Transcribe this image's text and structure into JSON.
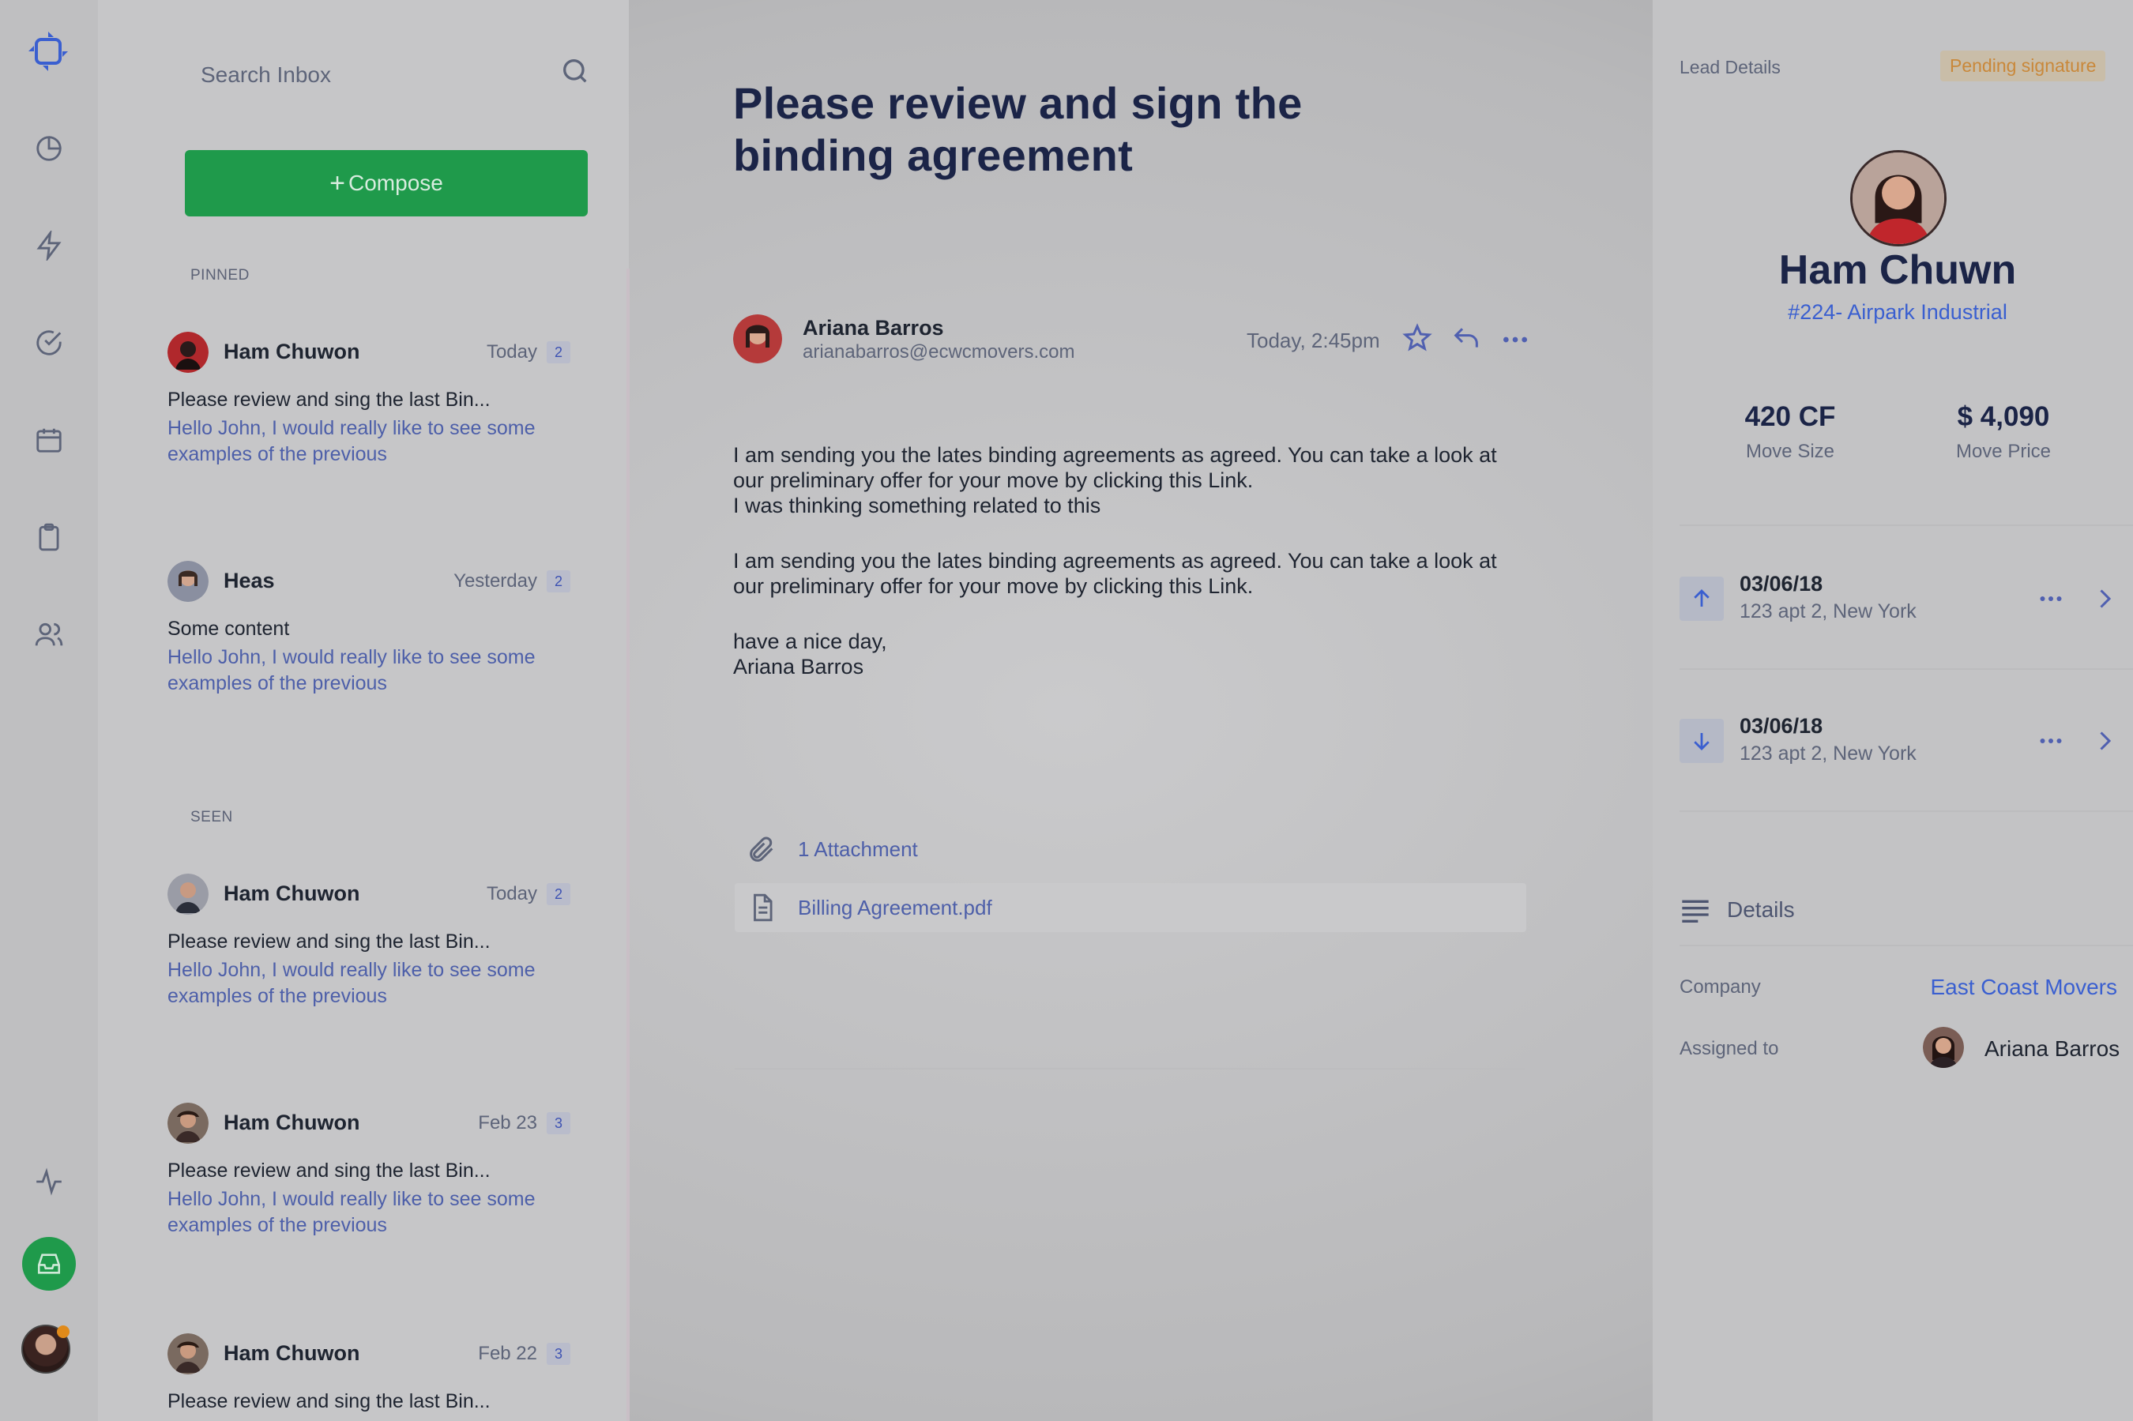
{
  "search": {
    "placeholder": "Search Inbox"
  },
  "compose": {
    "plus": "+",
    "label": "Compose"
  },
  "sections": {
    "pinned": "PINNED",
    "seen": "SEEN"
  },
  "messages": [
    {
      "sender": "Ham Chuwon",
      "date": "Today",
      "count": "2",
      "subject": "Please review and sing the last Bin...",
      "preview": "Hello John, I would really like to see some examples of the previous"
    },
    {
      "sender": "Heas",
      "date": "Yesterday",
      "count": "2",
      "subject": "Some content",
      "preview": "Hello John, I would really like to see some examples of the previous"
    },
    {
      "sender": "Ham Chuwon",
      "date": "Today",
      "count": "2",
      "subject": "Please review and sing the last Bin...",
      "preview": "Hello John, I would really like to see some examples of the previous"
    },
    {
      "sender": "Ham Chuwon",
      "date": "Feb 23",
      "count": "3",
      "subject": "Please review and sing the last Bin...",
      "preview": "Hello John, I would really like to see some examples of the previous"
    },
    {
      "sender": "Ham Chuwon",
      "date": "Feb 22",
      "count": "3",
      "subject": "Please review and sing the last Bin...",
      "preview": ""
    }
  ],
  "email": {
    "subject": "Please review and sign the binding agreement",
    "sender_name": "Ariana Barros",
    "sender_email": "arianabarros@ecwcmovers.com",
    "time": "Today, 2:45pm",
    "para1": [
      "I am sending you the lates binding agreements as agreed. You can take a look at",
      "our preliminary offer for your move by clicking this Link.",
      "I was thinking something related to this"
    ],
    "para2": [
      "I am sending you the lates binding agreements as agreed. You can take a look at",
      "our preliminary offer for your move by clicking this Link."
    ],
    "sign_off": [
      "have a nice day,",
      "Ariana Barros"
    ],
    "attachment_count": "1 Attachment",
    "attachment_file": "Billing Agreement.pdf"
  },
  "lead": {
    "section_title": "Lead Details",
    "status": "Pending signature",
    "name": "Ham Chuwn",
    "reference": "#224- Airpark Industrial",
    "move_size_value": "420 CF",
    "move_size_label": "Move Size",
    "move_price_value": "$ 4,090",
    "move_price_label": "Move Price",
    "moves": [
      {
        "date": "03/06/18",
        "address": "123 apt 2, New York",
        "direction": "up"
      },
      {
        "date": "03/06/18",
        "address": "123 apt 2, New York",
        "direction": "down"
      }
    ],
    "details_title": "Details",
    "company_label": "Company",
    "company_value": "East Coast Movers",
    "assigned_label": "Assigned to",
    "assigned_value": "Ariana Barros"
  },
  "icons": {
    "nav": [
      "logo-icon",
      "pie-chart-icon",
      "bolt-icon",
      "check-circle-icon",
      "calendar-icon",
      "clipboard-icon",
      "users-icon",
      "activity-icon",
      "inbox-icon"
    ],
    "accent": "#1f9a4b",
    "link": "#3a5fd0",
    "status": "#c9883a"
  }
}
